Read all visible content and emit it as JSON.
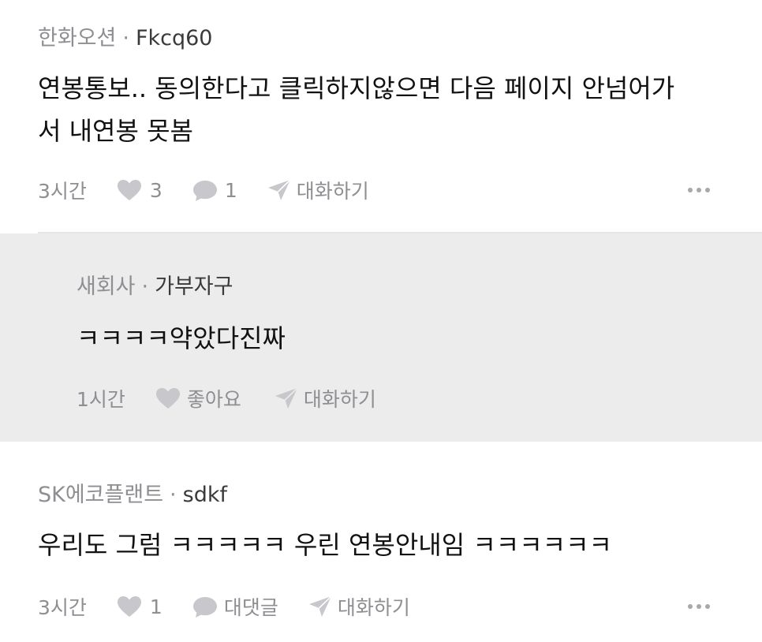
{
  "comments": [
    {
      "company": "한화오션",
      "separator": "·",
      "nickname": "Fkcq60",
      "body_lines": [
        "연봉통보.. 동의한다고 클릭하지않으면 다음 페이지 안넘어가",
        "서  내연봉 못봄"
      ],
      "time": "3시간",
      "likes": "3",
      "replies": "1",
      "chat_label": "대화하기"
    },
    {
      "company": "새회사",
      "separator": "·",
      "nickname": "가부자구",
      "body": "ㅋㅋㅋㅋ약았다진짜",
      "time": "1시간",
      "like_label": "좋아요",
      "chat_label": "대화하기"
    },
    {
      "company": "SK에코플랜트",
      "separator": "·",
      "nickname": "sdkf",
      "body": "우리도 그럼 ㅋㅋㅋㅋㅋ 우린 연봉안내임 ㅋㅋㅋㅋㅋㅋ",
      "time": "3시간",
      "likes": "1",
      "reply_label": "대댓글",
      "chat_label": "대화하기"
    }
  ],
  "icons": {
    "like": "heart-icon",
    "comment": "speech-bubble-icon",
    "chat": "paper-plane-icon",
    "more": "more-dots-icon"
  },
  "colors": {
    "reply_background": "#ececed",
    "secondary_text": "#8e8e93",
    "primary_text": "#111111"
  }
}
